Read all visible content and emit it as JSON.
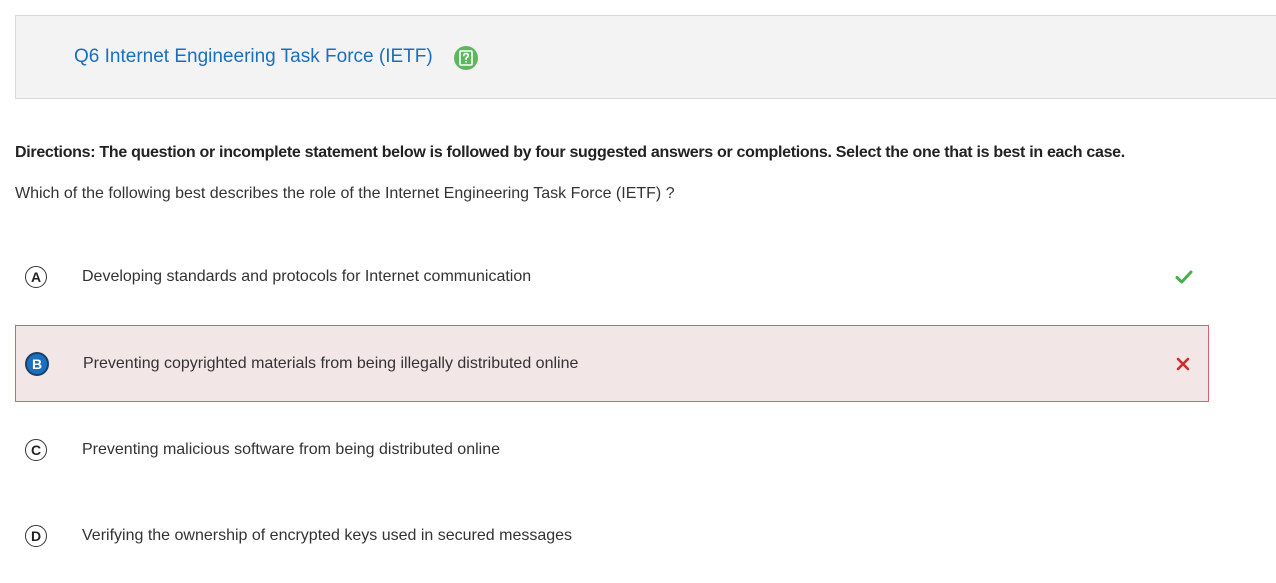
{
  "question": {
    "title": "Q6 Internet Engineering Task Force (IETF)",
    "help_icon": "question-mark-icon",
    "directions": "Directions: The question or incomplete statement below is followed by four suggested answers or completions. Select the one that is best in each case.",
    "prompt": "Which of the following best describes the role of the Internet Engineering Task Force (IETF) ?"
  },
  "options": [
    {
      "letter": "A",
      "text": "Developing standards and protocols for Internet communication",
      "status": "correct",
      "status_icon": "checkmark-icon"
    },
    {
      "letter": "B",
      "text": "Preventing copyrighted materials from being illegally distributed online",
      "status": "selected-incorrect",
      "status_icon": "cross-icon"
    },
    {
      "letter": "C",
      "text": "Preventing malicious software from being distributed online",
      "status": "none"
    },
    {
      "letter": "D",
      "text": "Verifying the ownership of encrypted keys used in secured messages",
      "status": "none"
    }
  ],
  "colors": {
    "title": "#1a6fbf",
    "help_icon_bg": "#5cb85c",
    "correct": "#4cae4c",
    "incorrect": "#c9302c",
    "selected_bg": "#f2e6e7",
    "selected_border": "#d9616f",
    "selected_letter_bg": "#1a6fbf"
  }
}
